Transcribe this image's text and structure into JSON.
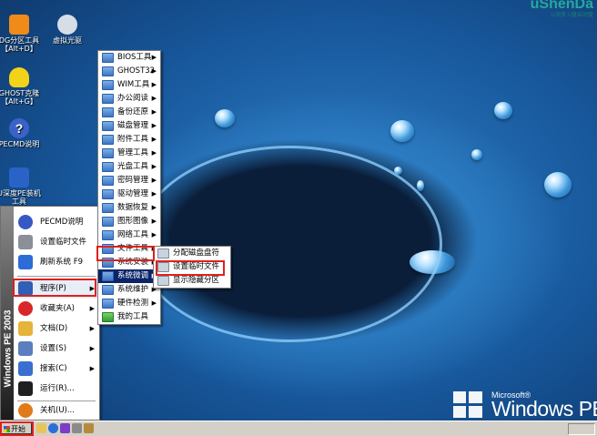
{
  "desktop": {
    "logo_text": "uShenDa",
    "logo_subtext": "U深度 U盘启动盘",
    "icons": [
      {
        "label": "DG分区工具\n【Alt+D】",
        "icon": "diskgenius-icon",
        "color": "#f08a18"
      },
      {
        "label": "虚拟光驱",
        "icon": "virtual-cdrom-icon",
        "color": "#d6dde6"
      },
      {
        "label": "GHOST克隆\n【Alt+G】",
        "icon": "ghost-icon",
        "color": "#f3d21a"
      },
      {
        "label": "PECMD说明",
        "icon": "help-icon",
        "color": "#3b62c9"
      },
      {
        "label": "U深度PE装机\n工具",
        "icon": "installer-icon",
        "color": "#2a63c8"
      }
    ],
    "brand": {
      "ms": "Microsoft®",
      "windows": "Windows PE"
    }
  },
  "start_menu": {
    "sidebar_text": "Windows PE 2003",
    "items": [
      {
        "label": "PECMD说明",
        "icon": "help-icon",
        "color": "#3658c4"
      },
      {
        "label": "设置临时文件",
        "icon": "drive-icon",
        "color": "#8a8f99"
      },
      {
        "label": "刷新系统 F9",
        "icon": "refresh-icon",
        "color": "#2d6bd6"
      },
      {
        "label": "程序(P)",
        "icon": "programs-icon",
        "color": "#2f5fb6",
        "arrow": "▶"
      },
      {
        "label": "收藏夹(A)",
        "icon": "favorites-icon",
        "color": "#d8262a",
        "arrow": "▶"
      },
      {
        "label": "文档(D)",
        "icon": "documents-icon",
        "color": "#e6b43a",
        "arrow": "▶"
      },
      {
        "label": "设置(S)",
        "icon": "settings-icon",
        "color": "#5a7ec0",
        "arrow": "▶"
      },
      {
        "label": "搜索(C)",
        "icon": "search-icon",
        "color": "#3a6fd0",
        "arrow": "▶"
      },
      {
        "label": "运行(R)...",
        "icon": "run-icon",
        "color": "#202020"
      },
      {
        "label": "关机(U)...",
        "icon": "shutdown-icon",
        "color": "#e07a1a"
      }
    ]
  },
  "programs_menu": {
    "items": [
      {
        "label": "BIOS工具",
        "arrow": "▶"
      },
      {
        "label": "GHOST32",
        "arrow": "▶"
      },
      {
        "label": "WIM工具",
        "arrow": "▶"
      },
      {
        "label": "办公阅读",
        "arrow": "▶"
      },
      {
        "label": "备份还原",
        "arrow": "▶"
      },
      {
        "label": "磁盘管理",
        "arrow": "▶"
      },
      {
        "label": "附件工具",
        "arrow": "▶"
      },
      {
        "label": "管理工具",
        "arrow": "▶"
      },
      {
        "label": "光盘工具",
        "arrow": "▶"
      },
      {
        "label": "密码管理",
        "arrow": "▶"
      },
      {
        "label": "驱动管理",
        "arrow": "▶"
      },
      {
        "label": "数据恢复",
        "arrow": "▶"
      },
      {
        "label": "图形图像",
        "arrow": "▶"
      },
      {
        "label": "网络工具",
        "arrow": "▶"
      },
      {
        "label": "文件工具",
        "arrow": "▶"
      },
      {
        "label": "系统安装",
        "arrow": "▶"
      },
      {
        "label": "系统微调",
        "arrow": "▶"
      },
      {
        "label": "系统维护",
        "arrow": "▶"
      },
      {
        "label": "硬件检测",
        "arrow": "▶"
      },
      {
        "label": "我的工具",
        "arrow": ""
      }
    ]
  },
  "submenu": {
    "items": [
      {
        "label": "分配磁盘盘符"
      },
      {
        "label": "设置临时文件"
      },
      {
        "label": "显示隐藏分区"
      }
    ]
  },
  "taskbar": {
    "start_label": "开始",
    "quick_launch": [
      "explorer-icon",
      "ie-icon",
      "media-icon",
      "tool-icon",
      "pen-icon"
    ]
  }
}
